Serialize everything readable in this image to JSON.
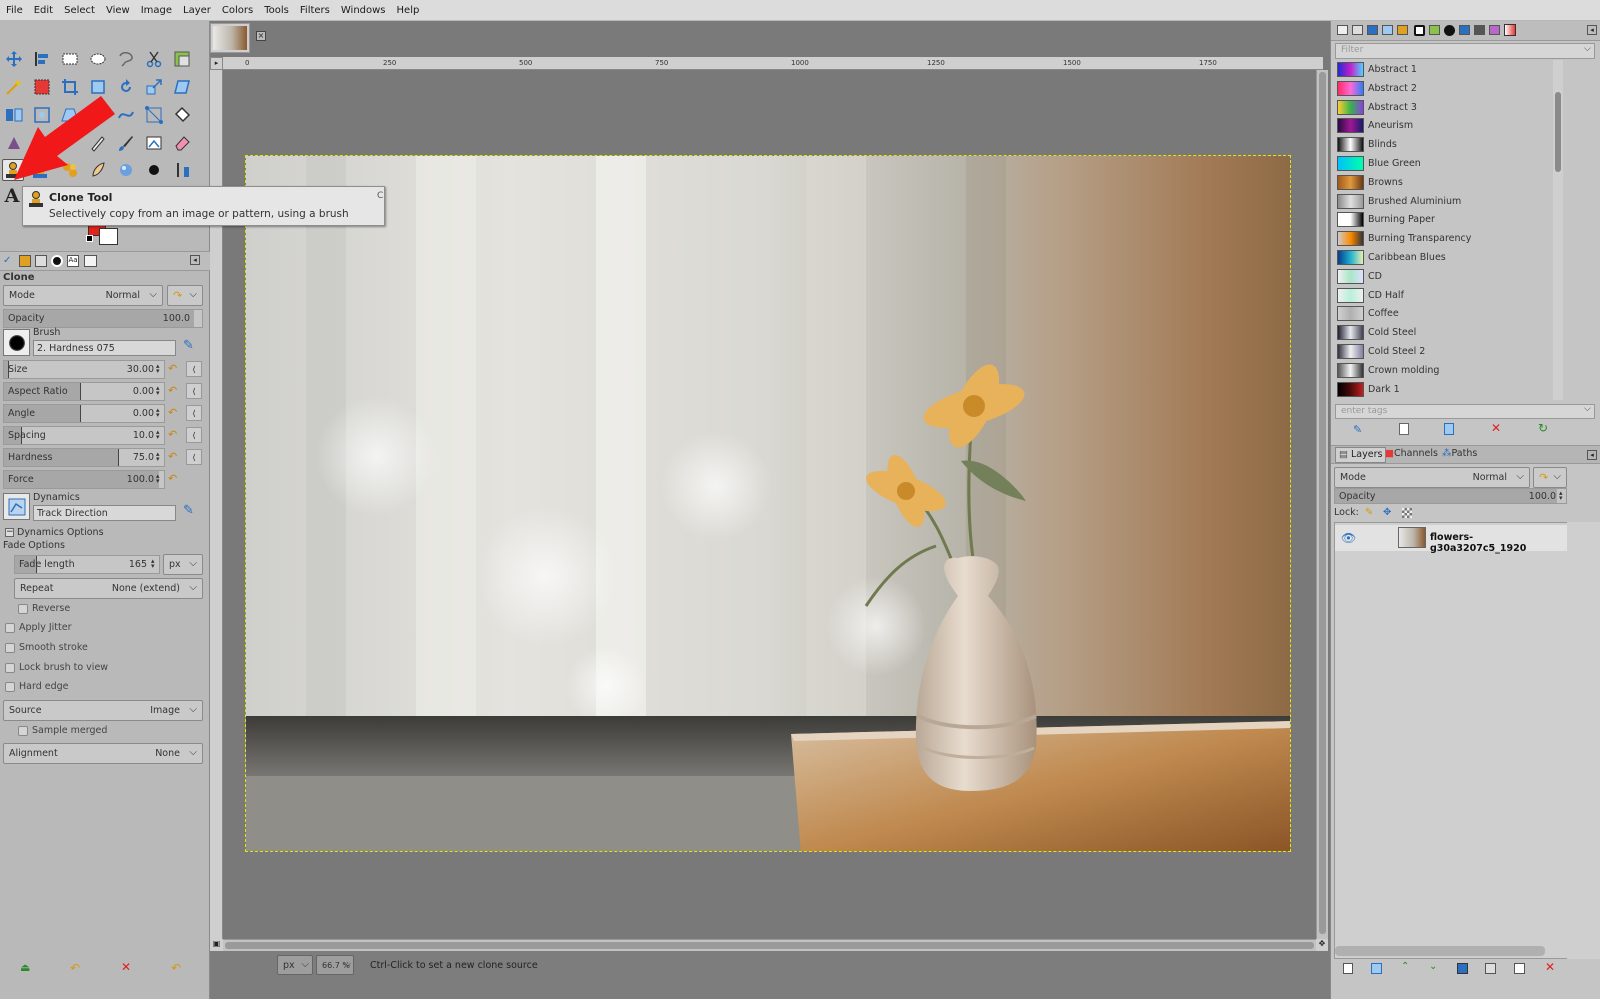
{
  "menu": [
    "File",
    "Edit",
    "Select",
    "View",
    "Image",
    "Layer",
    "Colors",
    "Tools",
    "Filters",
    "Windows",
    "Help"
  ],
  "tooltip": {
    "title": "Clone Tool",
    "description": "Selectively copy from an image or pattern, using a brush"
  },
  "tool_options": {
    "title": "Clone",
    "mode_label": "Mode",
    "mode_value": "Normal",
    "opacity_label": "Opacity",
    "opacity_value": "100.0",
    "brush_label": "Brush",
    "brush_value": "2. Hardness 075",
    "size_label": "Size",
    "size_value": "30.00",
    "aspect_label": "Aspect Ratio",
    "aspect_value": "0.00",
    "angle_label": "Angle",
    "angle_value": "0.00",
    "spacing_label": "Spacing",
    "spacing_value": "10.0",
    "hardness_label": "Hardness",
    "hardness_value": "75.0",
    "force_label": "Force",
    "force_value": "100.0",
    "dynamics_label": "Dynamics",
    "dynamics_value": "Track Direction",
    "dynamics_options": "Dynamics Options",
    "fade_options": "Fade Options",
    "fade_length_label": "Fade length",
    "fade_length_value": "165",
    "fade_unit": "px",
    "repeat_label": "Repeat",
    "repeat_value": "None (extend)",
    "reverse": "Reverse",
    "apply_jitter": "Apply Jitter",
    "smooth_stroke": "Smooth stroke",
    "lock_brush": "Lock brush to view",
    "hard_edge": "Hard edge",
    "source_label": "Source",
    "source_value": "Image",
    "sample_merged": "Sample merged",
    "alignment_label": "Alignment",
    "alignment_value": "None"
  },
  "ruler_ticks": [
    "0",
    "250",
    "500",
    "750",
    "1000",
    "1250",
    "1500",
    "1750"
  ],
  "status": {
    "unit": "px",
    "zoom": "66.7 %",
    "message": "Ctrl-Click to set a new clone source"
  },
  "gradients": {
    "filter_placeholder": "Filter",
    "tags_placeholder": "enter tags",
    "items": [
      {
        "name": "Abstract 1",
        "colors": [
          "#1f2bd6",
          "#c31fc9",
          "#4fd1ff"
        ]
      },
      {
        "name": "Abstract 2",
        "colors": [
          "#ff2a6a",
          "#ff6ad5",
          "#2e7dff"
        ]
      },
      {
        "name": "Abstract 3",
        "colors": [
          "#ffcc33",
          "#38b44a",
          "#8b3fe0"
        ]
      },
      {
        "name": "Aneurism",
        "colors": [
          "#2a0c40",
          "#a01896",
          "#1a1a6a"
        ]
      },
      {
        "name": "Blinds",
        "colors": [
          "#111111",
          "#ffffff",
          "#111111"
        ]
      },
      {
        "name": "Blue Green",
        "colors": [
          "#00c0ff",
          "#00e0d0",
          "#00ffb0"
        ]
      },
      {
        "name": "Browns",
        "colors": [
          "#a05a1c",
          "#e09a40",
          "#6b3a12"
        ]
      },
      {
        "name": "Brushed Aluminium",
        "colors": [
          "#8a8a8a",
          "#e0e0e0",
          "#9a9a9a"
        ]
      },
      {
        "name": "Burning Paper",
        "colors": [
          "#ffffff",
          "#ffffff",
          "#000000"
        ]
      },
      {
        "name": "Burning Transparency",
        "colors": [
          "#cccccc",
          "#ff8a00",
          "#333333"
        ]
      },
      {
        "name": "Caribbean Blues",
        "colors": [
          "#0a3c8a",
          "#1fb0d0",
          "#e8f0b0"
        ]
      },
      {
        "name": "CD",
        "colors": [
          "#f0f0f0",
          "#a8e6c8",
          "#e0e0ff"
        ]
      },
      {
        "name": "CD Half",
        "colors": [
          "#f0f0f0",
          "#b8f0d8",
          "#f0f0f0"
        ]
      },
      {
        "name": "Coffee",
        "colors": [
          "#d0d0d0",
          "#b0b0b0",
          "#d0d0d0"
        ]
      },
      {
        "name": "Cold Steel",
        "colors": [
          "#202030",
          "#e8e8f0",
          "#404050"
        ]
      },
      {
        "name": "Cold Steel 2",
        "colors": [
          "#303040",
          "#f0f0f0",
          "#8080a0"
        ]
      },
      {
        "name": "Crown molding",
        "colors": [
          "#555555",
          "#f5f5f5",
          "#333333"
        ]
      },
      {
        "name": "Dark 1",
        "colors": [
          "#000000",
          "#4a0a0a",
          "#c02020"
        ]
      }
    ]
  },
  "layers": {
    "tabs": [
      "Layers",
      "Channels",
      "Paths"
    ],
    "mode_label": "Mode",
    "mode_value": "Normal",
    "opacity_label": "Opacity",
    "opacity_value": "100.0",
    "lock_label": "Lock:",
    "layer_name": "flowers-g30a3207c5_1920"
  },
  "colors": {
    "fg": "#e2231a",
    "bg": "#ffffff",
    "marching_ants": "#e6e600",
    "active_tool_bg": "#e8e8e8"
  }
}
